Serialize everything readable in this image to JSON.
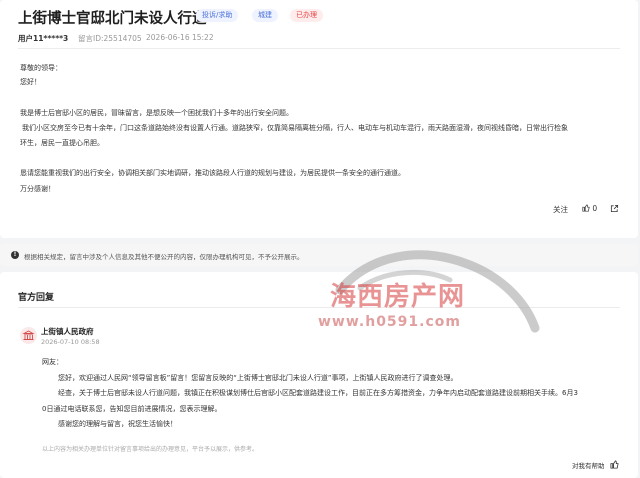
{
  "post": {
    "title": "上街博士官邸北门未设人行道",
    "tags": [
      "投诉/求助",
      "城建",
      "已办理"
    ],
    "user": "用户11*****3",
    "message_id": "留言ID:25514705",
    "date": "2026-06-16 15:22",
    "greeting": "尊敬的领导：",
    "hello": "您好！",
    "lines": [
      "我是博士后官邸小区的居民，冒昧留言，是想反映一个困扰我们十多年的出行安全问题。",
      "我们小区交房至今已有十余年，门口这条道路始终没有设置人行通。道路狭窄，仅靠简易隔离桩分隔，行人、电动车与机动车混行，雨天路面湿滑，夜间视线昏暗，日常出行检象",
      "环生，居民一直提心吊胆。",
      "恳请您能重视我们的出行安全，协调相关部门实地调研，推动该路段人行道的规划与建设，为居民提供一条安全的通行通道。",
      "万分感谢！"
    ],
    "actions": {
      "follow": "关注",
      "likes": "0"
    }
  },
  "notice": "根据相关规定，留言中涉及个人信息及其他不便公开的内容，仅限办理机构可见，不予公开展示。",
  "reply": {
    "heading": "官方回复",
    "org": "上街镇人民政府",
    "date": "2026-07-10 08:58",
    "lines": [
      "网友：",
      "您好，欢迎通过人民网“领导留言板”留言！您留言反映的“上街博士官邸北门未设人行道”事项，上街镇人民政府进行了调查处理。",
      "经查，关于博士后官邸未设人行道问题，我镇正在积极谋划博仕后官邸小区配套道路建设工作，目前正在多方筹措资金，力争年内启动配套道路建设前期相关手续。6月3",
      "0日通过电话联系您，告知您目前进展情况，您表示理解。",
      "感谢您的理解与留言，祝您生活愉快！"
    ],
    "footer_note": "以上内容为相关办理单位针对留言事项给出的办理意见，平台予以展示，供参考。",
    "helpful": "对我有帮助"
  },
  "watermark": {
    "text": "海西房产网",
    "url": "www.h0591.com"
  },
  "colors": {
    "tag_blue": "#4a6fd8",
    "tag_red": "#e54545",
    "watermark": "#d73c3c"
  }
}
